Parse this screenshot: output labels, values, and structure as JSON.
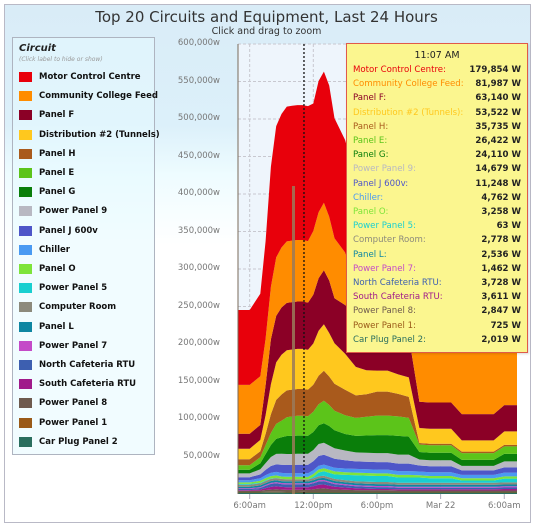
{
  "title": "Top 20 Circuits and Equipment, Last 24 Hours",
  "subtitle": "Click and drag to zoom",
  "legend": {
    "title": "Circuit",
    "hint": "(Click label to hide or show)"
  },
  "tooltip": {
    "time": "11:07 AM",
    "rows": [
      {
        "label": "Motor Control Centre:",
        "value": "179,854 W",
        "color": "#e8000b"
      },
      {
        "label": "Community College Feed:",
        "value": "81,987 W",
        "color": "#ff8c00"
      },
      {
        "label": "Panel F:",
        "value": "63,140 W",
        "color": "#8b0026"
      },
      {
        "label": "Distribution #2 (Tunnels):",
        "value": "53,522 W",
        "color": "#ffc81e"
      },
      {
        "label": "Panel H:",
        "value": "35,735 W",
        "color": "#a95a1c"
      },
      {
        "label": "Panel E:",
        "value": "26,422 W",
        "color": "#5cc41a"
      },
      {
        "label": "Panel G:",
        "value": "24,110 W",
        "color": "#0a7e0a"
      },
      {
        "label": "Power Panel 9:",
        "value": "14,679 W",
        "color": "#b8b8c2"
      },
      {
        "label": "Panel J 600v:",
        "value": "11,248 W",
        "color": "#4e56c8"
      },
      {
        "label": "Chiller:",
        "value": "4,762 W",
        "color": "#4a9af2"
      },
      {
        "label": "Panel O:",
        "value": "3,258 W",
        "color": "#7ee43a"
      },
      {
        "label": "Power Panel 5:",
        "value": "63 W",
        "color": "#19cfd0"
      },
      {
        "label": "Computer Room:",
        "value": "2,778 W",
        "color": "#8c8a7c"
      },
      {
        "label": "Panel L:",
        "value": "2,536 W",
        "color": "#0e86a2"
      },
      {
        "label": "Power Panel 7:",
        "value": "1,462 W",
        "color": "#c44ac8"
      },
      {
        "label": "North Cafeteria RTU:",
        "value": "3,728 W",
        "color": "#3d5fb0"
      },
      {
        "label": "South Cafeteria RTU:",
        "value": "3,611 W",
        "color": "#a01a8a"
      },
      {
        "label": "Power Panel 8:",
        "value": "2,847 W",
        "color": "#6e5a4e"
      },
      {
        "label": "Power Panel 1:",
        "value": "725 W",
        "color": "#9a5a18"
      },
      {
        "label": "Car Plug Panel 2:",
        "value": "2,019 W",
        "color": "#2a6e5e"
      }
    ]
  },
  "chart_data": {
    "type": "area",
    "stacked": true,
    "title": "Top 20 Circuits and Equipment, Last 24 Hours",
    "subtitle": "Click and drag to zoom",
    "xlabel": "",
    "ylabel": "",
    "ylim": [
      0,
      600000
    ],
    "y_ticks": [
      "50,000w",
      "100,000w",
      "150,000w",
      "200,000w",
      "250,000w",
      "300,000w",
      "350,000w",
      "400,000w",
      "450,000w",
      "500,000w",
      "550,000w",
      "600,000w"
    ],
    "y_tick_values": [
      50000,
      100000,
      150000,
      200000,
      250000,
      300000,
      350000,
      400000,
      450000,
      500000,
      550000,
      600000
    ],
    "x_ticks": [
      "6:00am",
      "12:00pm",
      "6:00pm",
      "Mar 22",
      "6:00am"
    ],
    "x_tick_hours": [
      6,
      12,
      18,
      24,
      30
    ],
    "x_range_hours": [
      4.9,
      31.2
    ],
    "crosshair_hour": 11.12,
    "grid": true,
    "legend_position": "left",
    "x_hours": [
      4.9,
      6,
      7,
      7.5,
      8,
      8.5,
      9,
      9.5,
      10,
      10.5,
      11,
      11.5,
      12,
      12.5,
      13,
      13.5,
      14,
      15,
      16,
      17,
      18,
      19,
      20,
      21,
      22,
      23,
      24,
      25,
      26,
      27,
      28,
      29,
      30,
      31.2
    ],
    "series": [
      {
        "name": "Car Plug Panel 2",
        "color": "#2a6e5e",
        "values": [
          2000,
          2000,
          2000,
          2100,
          2200,
          2200,
          2100,
          2000,
          2000,
          2000,
          2019,
          2000,
          2000,
          2000,
          2000,
          2000,
          2000,
          2000,
          2000,
          2000,
          2000,
          2000,
          2000,
          2000,
          2000,
          2000,
          2000,
          2000,
          2000,
          2000,
          2000,
          2000,
          2000,
          2000
        ]
      },
      {
        "name": "Power Panel 1",
        "color": "#9a5a18",
        "values": [
          700,
          700,
          700,
          700,
          700,
          720,
          720,
          720,
          725,
          725,
          725,
          725,
          725,
          725,
          725,
          725,
          725,
          725,
          725,
          725,
          725,
          725,
          725,
          725,
          725,
          725,
          725,
          725,
          725,
          725,
          725,
          725,
          725,
          725
        ]
      },
      {
        "name": "Power Panel 8",
        "color": "#6e5a4e",
        "values": [
          1500,
          1500,
          1800,
          2500,
          3000,
          3500,
          3000,
          2800,
          2800,
          2847,
          2847,
          2800,
          3500,
          4500,
          5000,
          4000,
          3500,
          3000,
          2500,
          2500,
          2500,
          2500,
          2000,
          2000,
          2000,
          2000,
          2000,
          2000,
          2000,
          2000,
          2000,
          2000,
          2000,
          2000
        ]
      },
      {
        "name": "South Cafeteria RTU",
        "color": "#a01a8a",
        "values": [
          1000,
          1000,
          1500,
          2500,
          3500,
          4000,
          3600,
          3600,
          3600,
          3611,
          3611,
          3500,
          4000,
          5000,
          5000,
          4500,
          3500,
          3000,
          2500,
          2000,
          1500,
          1500,
          1500,
          1500,
          1500,
          1500,
          1500,
          1500,
          1500,
          1500,
          1500,
          1500,
          2000,
          2000
        ]
      },
      {
        "name": "North Cafeteria RTU",
        "color": "#3d5fb0",
        "values": [
          1500,
          1500,
          2000,
          3000,
          4000,
          4000,
          3800,
          3700,
          3700,
          3728,
          3728,
          3700,
          4000,
          4500,
          4500,
          4000,
          3500,
          3000,
          2500,
          2500,
          2500,
          2500,
          2000,
          2000,
          2000,
          2000,
          2000,
          2000,
          2000,
          2000,
          2000,
          2000,
          2000,
          2000
        ]
      },
      {
        "name": "Power Panel 7",
        "color": "#c44ac8",
        "values": [
          1000,
          1000,
          1200,
          1400,
          1462,
          1462,
          1462,
          1462,
          1462,
          1462,
          1462,
          1462,
          1500,
          1500,
          1500,
          1500,
          1500,
          1500,
          1500,
          1500,
          1500,
          1500,
          1500,
          1500,
          1500,
          1500,
          1500,
          1500,
          1500,
          1500,
          1500,
          1500,
          1500,
          1500
        ]
      },
      {
        "name": "Panel L",
        "color": "#0e86a2",
        "values": [
          2000,
          2000,
          2200,
          2400,
          2500,
          2536,
          2536,
          2536,
          2536,
          2536,
          2536,
          2536,
          2600,
          2700,
          2700,
          2700,
          2600,
          2500,
          2500,
          2500,
          2500,
          2500,
          2500,
          2500,
          2500,
          2500,
          2500,
          2500,
          2500,
          2500,
          2500,
          2500,
          2500,
          2500
        ]
      },
      {
        "name": "Computer Room",
        "color": "#8c8a7c",
        "values": [
          2700,
          2700,
          2700,
          2750,
          2778,
          2778,
          2778,
          2778,
          2778,
          2778,
          2778,
          2778,
          2778,
          2778,
          2778,
          2778,
          2778,
          2778,
          2778,
          2778,
          2778,
          2778,
          2778,
          2778,
          2778,
          2778,
          2778,
          2778,
          2778,
          2778,
          2778,
          2778,
          2778,
          2778
        ]
      },
      {
        "name": "Power Panel 5",
        "color": "#19cfd0",
        "values": [
          1000,
          1000,
          1000,
          800,
          500,
          300,
          100,
          63,
          63,
          63,
          63,
          63,
          2000,
          5000,
          6000,
          6000,
          6000,
          7000,
          8000,
          8000,
          8000,
          8000,
          7000,
          7000,
          7000,
          6000,
          6000,
          6000,
          3000,
          3000,
          3000,
          3000,
          5000,
          5000
        ]
      },
      {
        "name": "Panel O",
        "color": "#7ee43a",
        "values": [
          2000,
          2000,
          2500,
          3000,
          3200,
          3258,
          3258,
          3258,
          3258,
          3258,
          3258,
          3258,
          3500,
          4000,
          4000,
          4000,
          4000,
          3500,
          3500,
          3500,
          3500,
          3500,
          3500,
          3500,
          3000,
          3000,
          3000,
          3000,
          3000,
          3000,
          3000,
          3000,
          3000,
          3000
        ]
      },
      {
        "name": "Chiller",
        "color": "#4a9af2",
        "values": [
          3000,
          3000,
          3500,
          4000,
          4500,
          4762,
          4762,
          4762,
          4762,
          4762,
          4762,
          4762,
          5000,
          5000,
          5000,
          5000,
          5000,
          5000,
          5000,
          5000,
          5000,
          5000,
          5000,
          5000,
          5000,
          5000,
          5000,
          5000,
          4500,
          4500,
          4500,
          4500,
          5000,
          5000
        ]
      },
      {
        "name": "Panel J 600v",
        "color": "#4e56c8",
        "values": [
          4000,
          4000,
          5000,
          7000,
          9000,
          10000,
          11000,
          11000,
          11000,
          11248,
          11248,
          11500,
          12000,
          13000,
          13000,
          12500,
          12000,
          11000,
          10000,
          10000,
          10000,
          10000,
          10000,
          10000,
          8000,
          8000,
          8000,
          8000,
          6000,
          6000,
          6000,
          6000,
          7000,
          7000
        ]
      },
      {
        "name": "Power Panel 9",
        "color": "#b8b8c2",
        "values": [
          5000,
          5000,
          7000,
          9000,
          12000,
          14000,
          14500,
          14679,
          14679,
          14679,
          14679,
          14679,
          15000,
          16000,
          16000,
          15000,
          14000,
          13000,
          12000,
          12000,
          12000,
          12000,
          12000,
          12000,
          8000,
          8000,
          8000,
          8000,
          6000,
          6000,
          6000,
          6000,
          8000,
          8000
        ]
      },
      {
        "name": "Panel G",
        "color": "#0a7e0a",
        "values": [
          5000,
          5000,
          8000,
          12000,
          16000,
          20000,
          22000,
          24000,
          24110,
          24110,
          24110,
          24000,
          24000,
          25000,
          26000,
          26000,
          24000,
          22000,
          22000,
          23000,
          24000,
          24000,
          25000,
          24000,
          10000,
          10000,
          10000,
          10000,
          8000,
          8000,
          8000,
          8000,
          10000,
          10000
        ]
      },
      {
        "name": "Panel E",
        "color": "#5cc41a",
        "values": [
          6000,
          6000,
          8000,
          12000,
          16000,
          20000,
          22000,
          25000,
          26000,
          26422,
          26422,
          26000,
          27000,
          28000,
          30000,
          28000,
          26000,
          25000,
          24000,
          25000,
          26000,
          26000,
          26000,
          25000,
          10000,
          10000,
          10000,
          10000,
          9000,
          9000,
          9000,
          9000,
          10000,
          10000
        ]
      },
      {
        "name": "Panel H",
        "color": "#a95a1c",
        "values": [
          8000,
          8000,
          8000,
          15000,
          25000,
          32000,
          35000,
          35735,
          35735,
          35735,
          35735,
          35500,
          36000,
          38000,
          40000,
          38000,
          36000,
          34000,
          30000,
          30000,
          32000,
          32000,
          30000,
          28000,
          2000,
          2000,
          2000,
          2000,
          2000,
          2000,
          2000,
          2000,
          2000,
          2000
        ]
      },
      {
        "name": "Distribution #2 (Tunnels)",
        "color": "#ffc81e",
        "values": [
          14000,
          14000,
          15000,
          25000,
          40000,
          50000,
          53000,
          53522,
          53522,
          53522,
          53522,
          53000,
          55000,
          60000,
          62000,
          58000,
          54000,
          48000,
          38000,
          32000,
          28000,
          28000,
          26000,
          26000,
          20000,
          20000,
          20000,
          20000,
          15000,
          15000,
          15000,
          15000,
          18000,
          18000
        ]
      },
      {
        "name": "Panel F",
        "color": "#8b0026",
        "values": [
          20000,
          20000,
          20000,
          40000,
          60000,
          62000,
          63000,
          63140,
          63140,
          63140,
          63140,
          63000,
          65000,
          70000,
          72000,
          70000,
          60000,
          65000,
          70000,
          70000,
          65000,
          60000,
          55000,
          55000,
          35000,
          35000,
          35000,
          35000,
          35000,
          35000,
          35000,
          35000,
          35000,
          35000
        ]
      },
      {
        "name": "Community College Feed",
        "color": "#ff8c00",
        "values": [
          65000,
          65000,
          65000,
          62000,
          70000,
          78000,
          80000,
          81987,
          81987,
          81987,
          81987,
          82000,
          85000,
          88000,
          90000,
          85000,
          80000,
          70000,
          40000,
          15000,
          10000,
          10000,
          10000,
          10000,
          100000,
          100000,
          105000,
          105000,
          105000,
          105000,
          110000,
          110000,
          105000,
          105000
        ]
      },
      {
        "name": "Motor Control Centre",
        "color": "#e8000b",
        "values": [
          100000,
          100000,
          110000,
          130000,
          160000,
          175000,
          178000,
          179854,
          179854,
          179854,
          179854,
          180000,
          170000,
          175000,
          175000,
          175000,
          160000,
          150000,
          140000,
          130000,
          120000,
          120000,
          120000,
          120000,
          60000,
          60000,
          35000,
          35000,
          30000,
          30000,
          30000,
          30000,
          30000,
          30000
        ]
      }
    ]
  }
}
